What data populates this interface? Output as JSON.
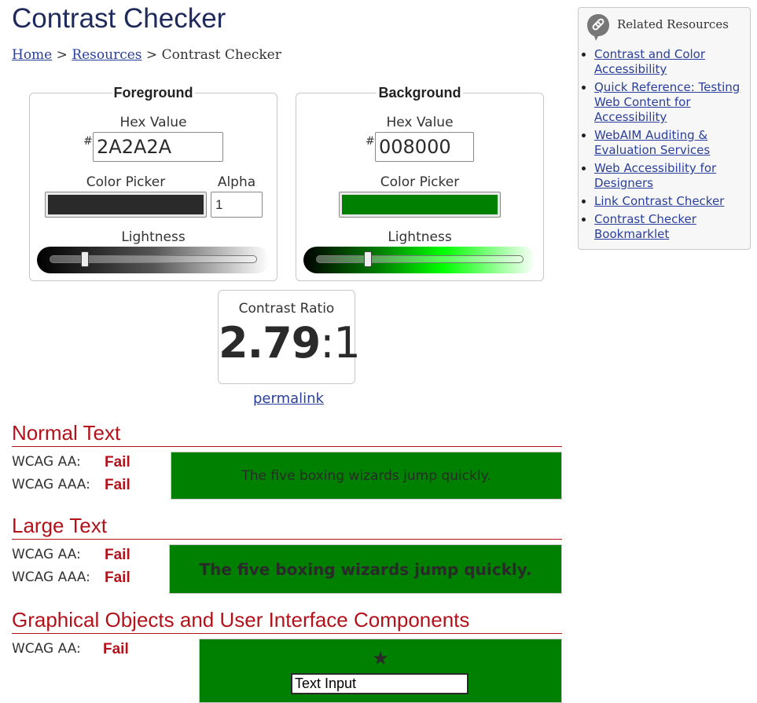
{
  "page": {
    "title": "Contrast Checker"
  },
  "breadcrumb": {
    "home": "Home",
    "sep1": ">",
    "resources": "Resources",
    "sep2": ">",
    "current": "Contrast Checker"
  },
  "foreground": {
    "legend": "Foreground",
    "hex_label": "Hex Value",
    "hash": "#",
    "hex_value": "2A2A2A",
    "picker_label": "Color Picker",
    "alpha_label": "Alpha",
    "alpha_value": "1",
    "lightness_label": "Lightness",
    "color": "#2a2a2a",
    "lightness_level": 0.17
  },
  "background": {
    "legend": "Background",
    "hex_label": "Hex Value",
    "hash": "#",
    "hex_value": "008000",
    "picker_label": "Color Picker",
    "lightness_label": "Lightness",
    "color": "#008000",
    "lightness_level": 0.25
  },
  "contrast": {
    "label": "Contrast Ratio",
    "value": "2.79",
    "suffix": ":1",
    "permalink": "permalink"
  },
  "normal_text": {
    "heading": "Normal Text",
    "aa_label": "WCAG AA:",
    "aa_result": "Fail",
    "aaa_label": "WCAG AAA:",
    "aaa_result": "Fail",
    "sample": "The five boxing wizards jump quickly."
  },
  "large_text": {
    "heading": "Large Text",
    "aa_label": "WCAG AA:",
    "aa_result": "Fail",
    "aaa_label": "WCAG AAA:",
    "aaa_result": "Fail",
    "sample": "The five boxing wizards jump quickly."
  },
  "graphical": {
    "heading": "Graphical Objects and User Interface Components",
    "aa_label": "WCAG AA:",
    "aa_result": "Fail",
    "star": "★",
    "input_value": "Text Input"
  },
  "sidebar": {
    "title": "Related Resources",
    "icon": "link-icon",
    "links": [
      "Contrast and Color Accessibility",
      "Quick Reference: Testing Web Content for Accessibility",
      "WebAIM Auditing & Evaluation Services",
      "Web Accessibility for Designers",
      "Link Contrast Checker",
      "Contrast Checker Bookmarklet"
    ]
  },
  "colors": {
    "fail": "#b3121b",
    "link": "#2a3f9c",
    "title": "#1f2a5c"
  }
}
